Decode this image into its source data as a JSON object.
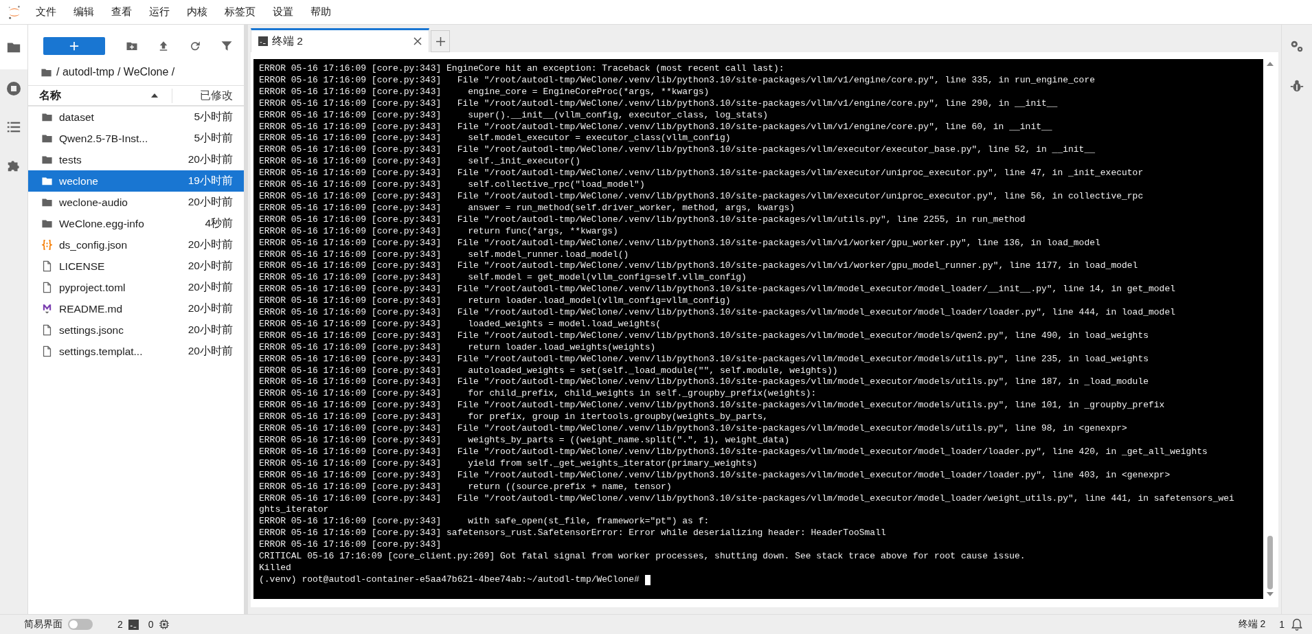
{
  "menu": [
    "文件",
    "编辑",
    "查看",
    "运行",
    "内核",
    "标签页",
    "设置",
    "帮助"
  ],
  "file_browser": {
    "breadcrumb": "/ autodl-tmp / WeClone /",
    "columns": {
      "name": "名称",
      "modified": "已修改"
    },
    "items": [
      {
        "name": "dataset",
        "modified": "5小时前",
        "kind": "folder",
        "selected": false
      },
      {
        "name": "Qwen2.5-7B-Inst...",
        "modified": "5小时前",
        "kind": "folder",
        "selected": false
      },
      {
        "name": "tests",
        "modified": "20小时前",
        "kind": "folder",
        "selected": false
      },
      {
        "name": "weclone",
        "modified": "19小时前",
        "kind": "folder",
        "selected": true
      },
      {
        "name": "weclone-audio",
        "modified": "20小时前",
        "kind": "folder",
        "selected": false
      },
      {
        "name": "WeClone.egg-info",
        "modified": "4秒前",
        "kind": "folder",
        "selected": false
      },
      {
        "name": "ds_config.json",
        "modified": "20小时前",
        "kind": "json",
        "selected": false
      },
      {
        "name": "LICENSE",
        "modified": "20小时前",
        "kind": "file",
        "selected": false
      },
      {
        "name": "pyproject.toml",
        "modified": "20小时前",
        "kind": "file",
        "selected": false
      },
      {
        "name": "README.md",
        "modified": "20小时前",
        "kind": "markdown",
        "selected": false
      },
      {
        "name": "settings.jsonc",
        "modified": "20小时前",
        "kind": "file",
        "selected": false
      },
      {
        "name": "settings.templat...",
        "modified": "20小时前",
        "kind": "file",
        "selected": false
      }
    ]
  },
  "tabs": [
    {
      "label": "终端 2",
      "selected": true
    }
  ],
  "terminal": {
    "lines": [
      "ERROR 05-16 17:16:09 [core.py:343] EngineCore hit an exception: Traceback (most recent call last):",
      "ERROR 05-16 17:16:09 [core.py:343]   File \"/root/autodl-tmp/WeClone/.venv/lib/python3.10/site-packages/vllm/v1/engine/core.py\", line 335, in run_engine_core",
      "ERROR 05-16 17:16:09 [core.py:343]     engine_core = EngineCoreProc(*args, **kwargs)",
      "ERROR 05-16 17:16:09 [core.py:343]   File \"/root/autodl-tmp/WeClone/.venv/lib/python3.10/site-packages/vllm/v1/engine/core.py\", line 290, in __init__",
      "ERROR 05-16 17:16:09 [core.py:343]     super().__init__(vllm_config, executor_class, log_stats)",
      "ERROR 05-16 17:16:09 [core.py:343]   File \"/root/autodl-tmp/WeClone/.venv/lib/python3.10/site-packages/vllm/v1/engine/core.py\", line 60, in __init__",
      "ERROR 05-16 17:16:09 [core.py:343]     self.model_executor = executor_class(vllm_config)",
      "ERROR 05-16 17:16:09 [core.py:343]   File \"/root/autodl-tmp/WeClone/.venv/lib/python3.10/site-packages/vllm/executor/executor_base.py\", line 52, in __init__",
      "ERROR 05-16 17:16:09 [core.py:343]     self._init_executor()",
      "ERROR 05-16 17:16:09 [core.py:343]   File \"/root/autodl-tmp/WeClone/.venv/lib/python3.10/site-packages/vllm/executor/uniproc_executor.py\", line 47, in _init_executor",
      "ERROR 05-16 17:16:09 [core.py:343]     self.collective_rpc(\"load_model\")",
      "ERROR 05-16 17:16:09 [core.py:343]   File \"/root/autodl-tmp/WeClone/.venv/lib/python3.10/site-packages/vllm/executor/uniproc_executor.py\", line 56, in collective_rpc",
      "ERROR 05-16 17:16:09 [core.py:343]     answer = run_method(self.driver_worker, method, args, kwargs)",
      "ERROR 05-16 17:16:09 [core.py:343]   File \"/root/autodl-tmp/WeClone/.venv/lib/python3.10/site-packages/vllm/utils.py\", line 2255, in run_method",
      "ERROR 05-16 17:16:09 [core.py:343]     return func(*args, **kwargs)",
      "ERROR 05-16 17:16:09 [core.py:343]   File \"/root/autodl-tmp/WeClone/.venv/lib/python3.10/site-packages/vllm/v1/worker/gpu_worker.py\", line 136, in load_model",
      "ERROR 05-16 17:16:09 [core.py:343]     self.model_runner.load_model()",
      "ERROR 05-16 17:16:09 [core.py:343]   File \"/root/autodl-tmp/WeClone/.venv/lib/python3.10/site-packages/vllm/v1/worker/gpu_model_runner.py\", line 1177, in load_model",
      "ERROR 05-16 17:16:09 [core.py:343]     self.model = get_model(vllm_config=self.vllm_config)",
      "ERROR 05-16 17:16:09 [core.py:343]   File \"/root/autodl-tmp/WeClone/.venv/lib/python3.10/site-packages/vllm/model_executor/model_loader/__init__.py\", line 14, in get_model",
      "ERROR 05-16 17:16:09 [core.py:343]     return loader.load_model(vllm_config=vllm_config)",
      "ERROR 05-16 17:16:09 [core.py:343]   File \"/root/autodl-tmp/WeClone/.venv/lib/python3.10/site-packages/vllm/model_executor/model_loader/loader.py\", line 444, in load_model",
      "ERROR 05-16 17:16:09 [core.py:343]     loaded_weights = model.load_weights(",
      "ERROR 05-16 17:16:09 [core.py:343]   File \"/root/autodl-tmp/WeClone/.venv/lib/python3.10/site-packages/vllm/model_executor/models/qwen2.py\", line 490, in load_weights",
      "ERROR 05-16 17:16:09 [core.py:343]     return loader.load_weights(weights)",
      "ERROR 05-16 17:16:09 [core.py:343]   File \"/root/autodl-tmp/WeClone/.venv/lib/python3.10/site-packages/vllm/model_executor/models/utils.py\", line 235, in load_weights",
      "ERROR 05-16 17:16:09 [core.py:343]     autoloaded_weights = set(self._load_module(\"\", self.module, weights))",
      "ERROR 05-16 17:16:09 [core.py:343]   File \"/root/autodl-tmp/WeClone/.venv/lib/python3.10/site-packages/vllm/model_executor/models/utils.py\", line 187, in _load_module",
      "ERROR 05-16 17:16:09 [core.py:343]     for child_prefix, child_weights in self._groupby_prefix(weights):",
      "ERROR 05-16 17:16:09 [core.py:343]   File \"/root/autodl-tmp/WeClone/.venv/lib/python3.10/site-packages/vllm/model_executor/models/utils.py\", line 101, in _groupby_prefix",
      "ERROR 05-16 17:16:09 [core.py:343]     for prefix, group in itertools.groupby(weights_by_parts,",
      "ERROR 05-16 17:16:09 [core.py:343]   File \"/root/autodl-tmp/WeClone/.venv/lib/python3.10/site-packages/vllm/model_executor/models/utils.py\", line 98, in <genexpr>",
      "ERROR 05-16 17:16:09 [core.py:343]     weights_by_parts = ((weight_name.split(\".\", 1), weight_data)",
      "ERROR 05-16 17:16:09 [core.py:343]   File \"/root/autodl-tmp/WeClone/.venv/lib/python3.10/site-packages/vllm/model_executor/model_loader/loader.py\", line 420, in _get_all_weights",
      "ERROR 05-16 17:16:09 [core.py:343]     yield from self._get_weights_iterator(primary_weights)",
      "ERROR 05-16 17:16:09 [core.py:343]   File \"/root/autodl-tmp/WeClone/.venv/lib/python3.10/site-packages/vllm/model_executor/model_loader/loader.py\", line 403, in <genexpr>",
      "ERROR 05-16 17:16:09 [core.py:343]     return ((source.prefix + name, tensor)",
      "ERROR 05-16 17:16:09 [core.py:343]   File \"/root/autodl-tmp/WeClone/.venv/lib/python3.10/site-packages/vllm/model_executor/model_loader/weight_utils.py\", line 441, in safetensors_wei",
      "ghts_iterator",
      "ERROR 05-16 17:16:09 [core.py:343]     with safe_open(st_file, framework=\"pt\") as f:",
      "ERROR 05-16 17:16:09 [core.py:343] safetensors_rust.SafetensorError: Error while deserializing header: HeaderTooSmall",
      "ERROR 05-16 17:16:09 [core.py:343]",
      "CRITICAL 05-16 17:16:09 [core_client.py:269] Got fatal signal from worker processes, shutting down. See stack trace above for root cause issue.",
      "Killed"
    ],
    "prompt": "(.venv) root@autodl-container-e5aa47b621-4bee74ab:~/autodl-tmp/WeClone#"
  },
  "status_bar": {
    "simple_mode": {
      "label": "简易界面",
      "on": false
    },
    "terminals": "2",
    "kernels": "0",
    "active": "终端 2",
    "notifications": "1"
  }
}
